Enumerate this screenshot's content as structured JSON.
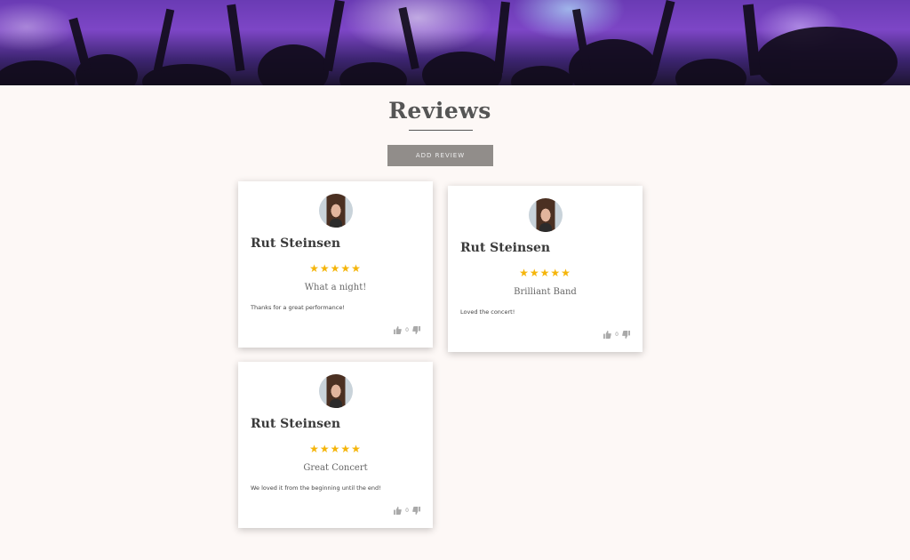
{
  "page": {
    "title": "Reviews",
    "add_review_label": "ADD REVIEW"
  },
  "colors": {
    "background": "#fdf8f6",
    "button": "#918d8a",
    "star": "#f5b50a",
    "hero": "#7d46c6"
  },
  "reviews": [
    {
      "author": "Rut Steinsen",
      "stars": "★★★★★",
      "rating": 5,
      "title": "What a night!",
      "body": "Thanks for a great performance!",
      "upvotes": "0"
    },
    {
      "author": "Rut Steinsen",
      "stars": "★★★★★",
      "rating": 5,
      "title": "Brilliant Band",
      "body": "Loved the concert!",
      "upvotes": "0"
    },
    {
      "author": "Rut Steinsen",
      "stars": "★★★★★",
      "rating": 5,
      "title": "Great Concert",
      "body": "We loved it from the beginning until the end!",
      "upvotes": "0"
    }
  ]
}
